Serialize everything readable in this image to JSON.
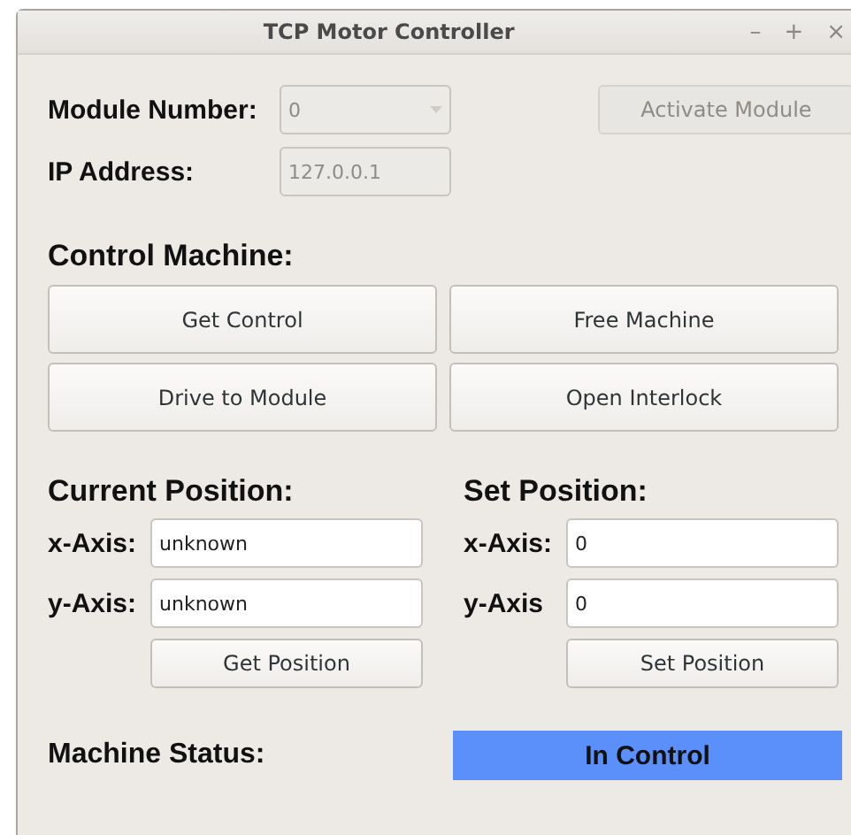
{
  "window": {
    "title": "TCP Motor Controller",
    "controls": [
      "–",
      "+",
      "×"
    ]
  },
  "module": {
    "label": "Module Number:",
    "value": "0",
    "disabled": true
  },
  "activate_button": {
    "label": "Activate Module",
    "disabled": true
  },
  "ip": {
    "label": "IP Address:",
    "value": "127.0.0.1",
    "disabled": true
  },
  "control": {
    "heading": "Control Machine:",
    "buttons": [
      "Get Control",
      "Free Machine",
      "Drive to Module",
      "Open Interlock"
    ]
  },
  "current_position": {
    "heading": "Current Position:",
    "fields": [
      {
        "label": "x-Axis:",
        "value": "unknown"
      },
      {
        "label": "y-Axis:",
        "value": "unknown"
      }
    ],
    "button": "Get Position"
  },
  "set_position": {
    "heading": "Set Position:",
    "fields": [
      {
        "label": "x-Axis:",
        "value": "0"
      },
      {
        "label": "y-Axis",
        "value": "0"
      }
    ],
    "button": "Set Position"
  },
  "status": {
    "label": "Machine Status:",
    "value": "In Control",
    "color": "#5b8ff9"
  }
}
